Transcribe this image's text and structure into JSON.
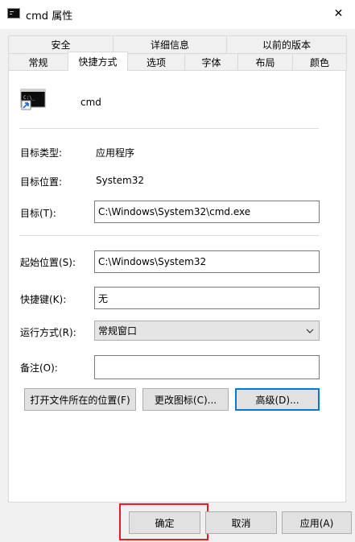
{
  "window": {
    "title": "cmd 属性",
    "close_icon": "✕"
  },
  "tabs_row1": [
    {
      "label": "安全"
    },
    {
      "label": "详细信息"
    },
    {
      "label": "以前的版本"
    }
  ],
  "tabs_row2": [
    {
      "label": "常规"
    },
    {
      "label": "快捷方式",
      "active": true
    },
    {
      "label": "选项"
    },
    {
      "label": "字体"
    },
    {
      "label": "布局"
    },
    {
      "label": "颜色"
    }
  ],
  "shortcut": {
    "name": "cmd",
    "target_type_label": "目标类型:",
    "target_type_value": "应用程序",
    "target_location_label": "目标位置:",
    "target_location_value": "System32",
    "target_label": "目标(T):",
    "target_value": "C:\\Windows\\System32\\cmd.exe",
    "start_in_label": "起始位置(S):",
    "start_in_value": "C:\\Windows\\System32",
    "hotkey_label": "快捷键(K):",
    "hotkey_value": "无",
    "run_label": "运行方式(R):",
    "run_value": "常规窗口",
    "comment_label": "备注(O):",
    "comment_value": ""
  },
  "actions": {
    "open_location": "打开文件所在的位置(F)",
    "change_icon": "更改图标(C)...",
    "advanced": "高级(D)..."
  },
  "footer": {
    "ok": "确定",
    "cancel": "取消",
    "apply": "应用(A)"
  },
  "colors": {
    "highlight": "#e51c23",
    "focus": "#0078d7"
  }
}
